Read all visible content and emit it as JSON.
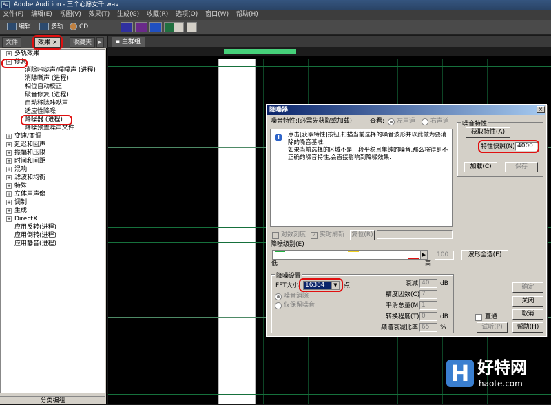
{
  "window": {
    "title": "Adobe Audition - 三个心愿女千.wav",
    "app_icon": "Au"
  },
  "menu": [
    "文件(F)",
    "编辑(E)",
    "视图(V)",
    "效果(T)",
    "生成(G)",
    "收藏(R)",
    "选项(O)",
    "窗口(W)",
    "帮助(H)"
  ],
  "toolbar": {
    "edit": "编辑",
    "multitrack": "多轨",
    "cd": "CD"
  },
  "left_panel": {
    "tabs": [
      "文件",
      "效果",
      "收藏夹"
    ],
    "tab_close": "×",
    "tab_scroll": "▸",
    "tree": [
      {
        "type": "folder",
        "label": "多轨效果",
        "toggle": "+"
      },
      {
        "type": "folder",
        "label": "修复",
        "toggle": "−"
      },
      {
        "type": "child",
        "label": "消除咔哒声/噗噗声 (进程)"
      },
      {
        "type": "child",
        "label": "消除嘶声 (进程)"
      },
      {
        "type": "child",
        "label": "相位自动校正"
      },
      {
        "type": "child",
        "label": "破音修复 (进程)"
      },
      {
        "type": "child",
        "label": "自动移除咔哒声"
      },
      {
        "type": "child",
        "label": "适应性降噪"
      },
      {
        "type": "child",
        "label": "降噪器 (进程)"
      },
      {
        "type": "child",
        "label": "降噪预置噪声文件"
      },
      {
        "type": "folder",
        "label": "变速/变调",
        "toggle": "+"
      },
      {
        "type": "folder",
        "label": "延迟和回声",
        "toggle": "+"
      },
      {
        "type": "folder",
        "label": "振幅和压限",
        "toggle": "+"
      },
      {
        "type": "folder",
        "label": "时间和间距",
        "toggle": "+"
      },
      {
        "type": "folder",
        "label": "混响",
        "toggle": "+"
      },
      {
        "type": "folder",
        "label": "滤波和均衡",
        "toggle": "+"
      },
      {
        "type": "folder",
        "label": "特殊",
        "toggle": "+"
      },
      {
        "type": "folder",
        "label": "立体声声像",
        "toggle": "+"
      },
      {
        "type": "folder",
        "label": "调制",
        "toggle": "+"
      },
      {
        "type": "folder",
        "label": "生成",
        "toggle": "+"
      },
      {
        "type": "folder",
        "label": "DirectX",
        "toggle": "+"
      },
      {
        "type": "item",
        "label": "应用反转(进程)"
      },
      {
        "type": "item",
        "label": "应用倒转(进程)"
      },
      {
        "type": "item",
        "label": "应用静音(进程)"
      }
    ],
    "bottom": "分类编组"
  },
  "wave": {
    "tab": "主群组"
  },
  "dialog": {
    "title": "降噪器",
    "close": "×",
    "profile_label": "噪音特性:(必需先获取或加载)",
    "view_label": "查看:",
    "left_channel": "左声道",
    "right_channel": "右声道",
    "info_icon": "i",
    "info_line1": "点击[获取特性]按钮,扫描当前选择的噪音波形并以此做为要消除的噪音基准.",
    "info_line2": "如果当前选择的区域不是一段平稳且单纯的噪音,那么将得到不正确的噪音特性,会直接影响到降噪效果.",
    "noise_group": "噪音特性",
    "get_profile": "获取特性(A)",
    "snapshots_label": "特性快照(N)",
    "snapshots_value": "4000",
    "load": "加载(C)",
    "save": "保存",
    "log_scale": "对数刻度",
    "live_update": "实时刷新",
    "reset": "复位(R)",
    "reduction_level": "降噪级别(E)",
    "low": "低",
    "high": "高",
    "level_value": "100",
    "level_fraction": 1.0,
    "select_all_wave": "波形全选(E)",
    "settings_group": "降噪设置",
    "fft_label": "FFT大小",
    "fft_value": "16384",
    "fft_arrow": "▼",
    "points": "点",
    "remove_noise": "噪音消除",
    "keep_noise": "仅保留噪音",
    "decay_label": "衰减",
    "decay_value": "40",
    "decay_unit": "dB",
    "precision_label": "精度因数(C)",
    "precision_value": "7",
    "smoothing_label": "平滑总量(M)",
    "smoothing_value": "1",
    "transition_label": "转换程度(T)",
    "transition_value": "0",
    "transition_unit": "dB",
    "spectral_label": "频谱衰减比率",
    "spectral_value": "65",
    "spectral_unit": "%",
    "ok": "确定",
    "close_btn": "关闭",
    "cancel": "取消",
    "bypass": "直通",
    "preview": "试听(P)",
    "help": "帮助(H)"
  },
  "watermark": {
    "icon": "H",
    "brand": "好特网",
    "domain": "haote.com"
  },
  "colors": {
    "selection": "#ffffff",
    "waveform_grid": "#16703c",
    "overview": "#46d07a",
    "annotation": "#e01010"
  }
}
